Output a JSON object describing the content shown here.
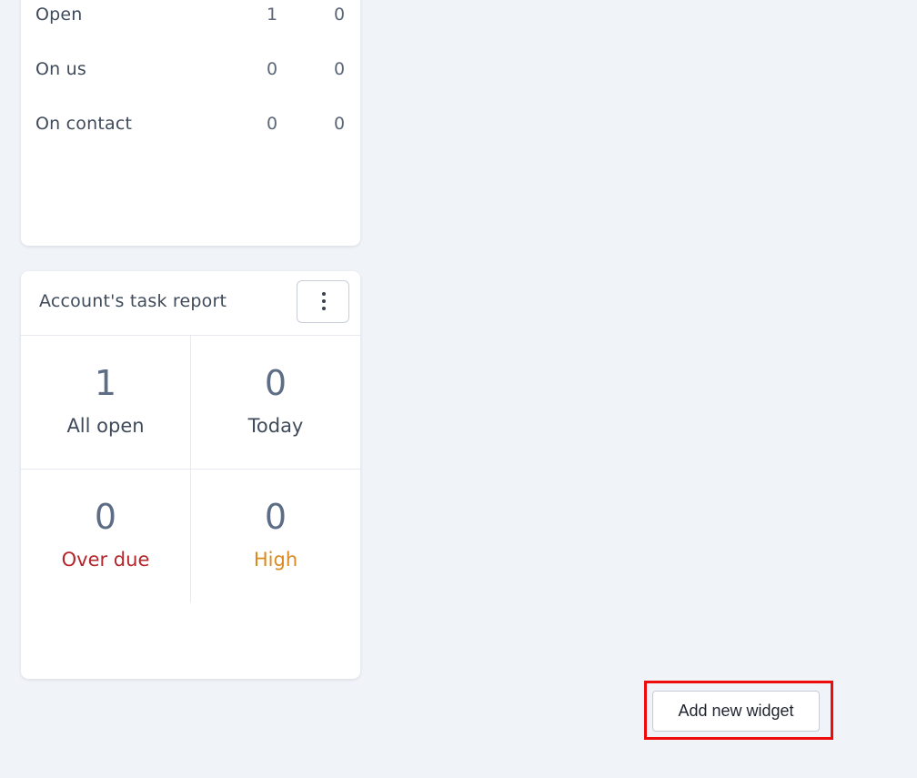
{
  "status_card": {
    "rows": [
      {
        "label": "Open",
        "value_a": "1",
        "value_b": "0"
      },
      {
        "label": "On us",
        "value_a": "0",
        "value_b": "0"
      },
      {
        "label": "On contact",
        "value_a": "0",
        "value_b": "0"
      }
    ]
  },
  "task_report": {
    "title": "Account's task report",
    "menu_icon": "more-vertical-icon",
    "cells": [
      {
        "value": "1",
        "label": "All open"
      },
      {
        "value": "0",
        "label": "Today"
      },
      {
        "value": "0",
        "label": "Over due",
        "color": "#b3262c"
      },
      {
        "value": "0",
        "label": "High",
        "color": "#d98a1e"
      }
    ]
  },
  "add_widget": {
    "label": "Add new widget",
    "highlight_color": "#ee0b0b"
  }
}
